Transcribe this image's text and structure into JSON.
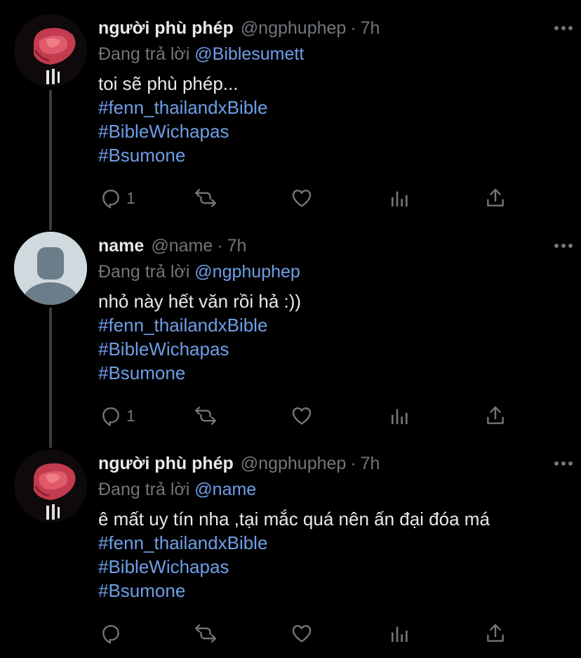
{
  "tweets": [
    {
      "display_name": "người phù phép",
      "handle": "@ngphuphep",
      "dot": "·",
      "time": "7h",
      "replying_prefix": "Đang trả lời",
      "replying_to": "@Biblesumett",
      "text": "toi sẽ phù phép...",
      "hashtags": [
        "#fenn_thailandxBible",
        "#BibleWichapas",
        "#Bsumone"
      ],
      "reply_count": "1",
      "avatar": "rose-photo"
    },
    {
      "display_name": "name",
      "handle": "@name",
      "dot": "·",
      "time": "7h",
      "replying_prefix": "Đang trả lời",
      "replying_to": "@ngphuphep",
      "text": "nhỏ này hết văn rồi hả :))",
      "hashtags": [
        "#fenn_thailandxBible",
        "#BibleWichapas",
        "#Bsumone"
      ],
      "reply_count": "1",
      "avatar": "default-avatar"
    },
    {
      "display_name": "người phù phép",
      "handle": "@ngphuphep",
      "dot": "·",
      "time": "7h",
      "replying_prefix": "Đang trả lời",
      "replying_to": "@name",
      "text": "ê mất uy tín nha ,tại mắc quá nên ấn đại đóa má",
      "hashtags": [
        "#fenn_thailandxBible",
        "#BibleWichapas",
        "#Bsumone"
      ],
      "reply_count": "",
      "avatar": "rose-photo"
    }
  ],
  "icons": {
    "reply": "reply-icon",
    "retweet": "retweet-icon",
    "like": "like-icon",
    "analytics": "analytics-icon",
    "share": "share-icon",
    "more": "more-icon"
  },
  "colors": {
    "background": "#000000",
    "text": "#e7e9ea",
    "secondary": "#71767b",
    "link": "#6f9ee8",
    "thread_line": "#3a3d42"
  }
}
